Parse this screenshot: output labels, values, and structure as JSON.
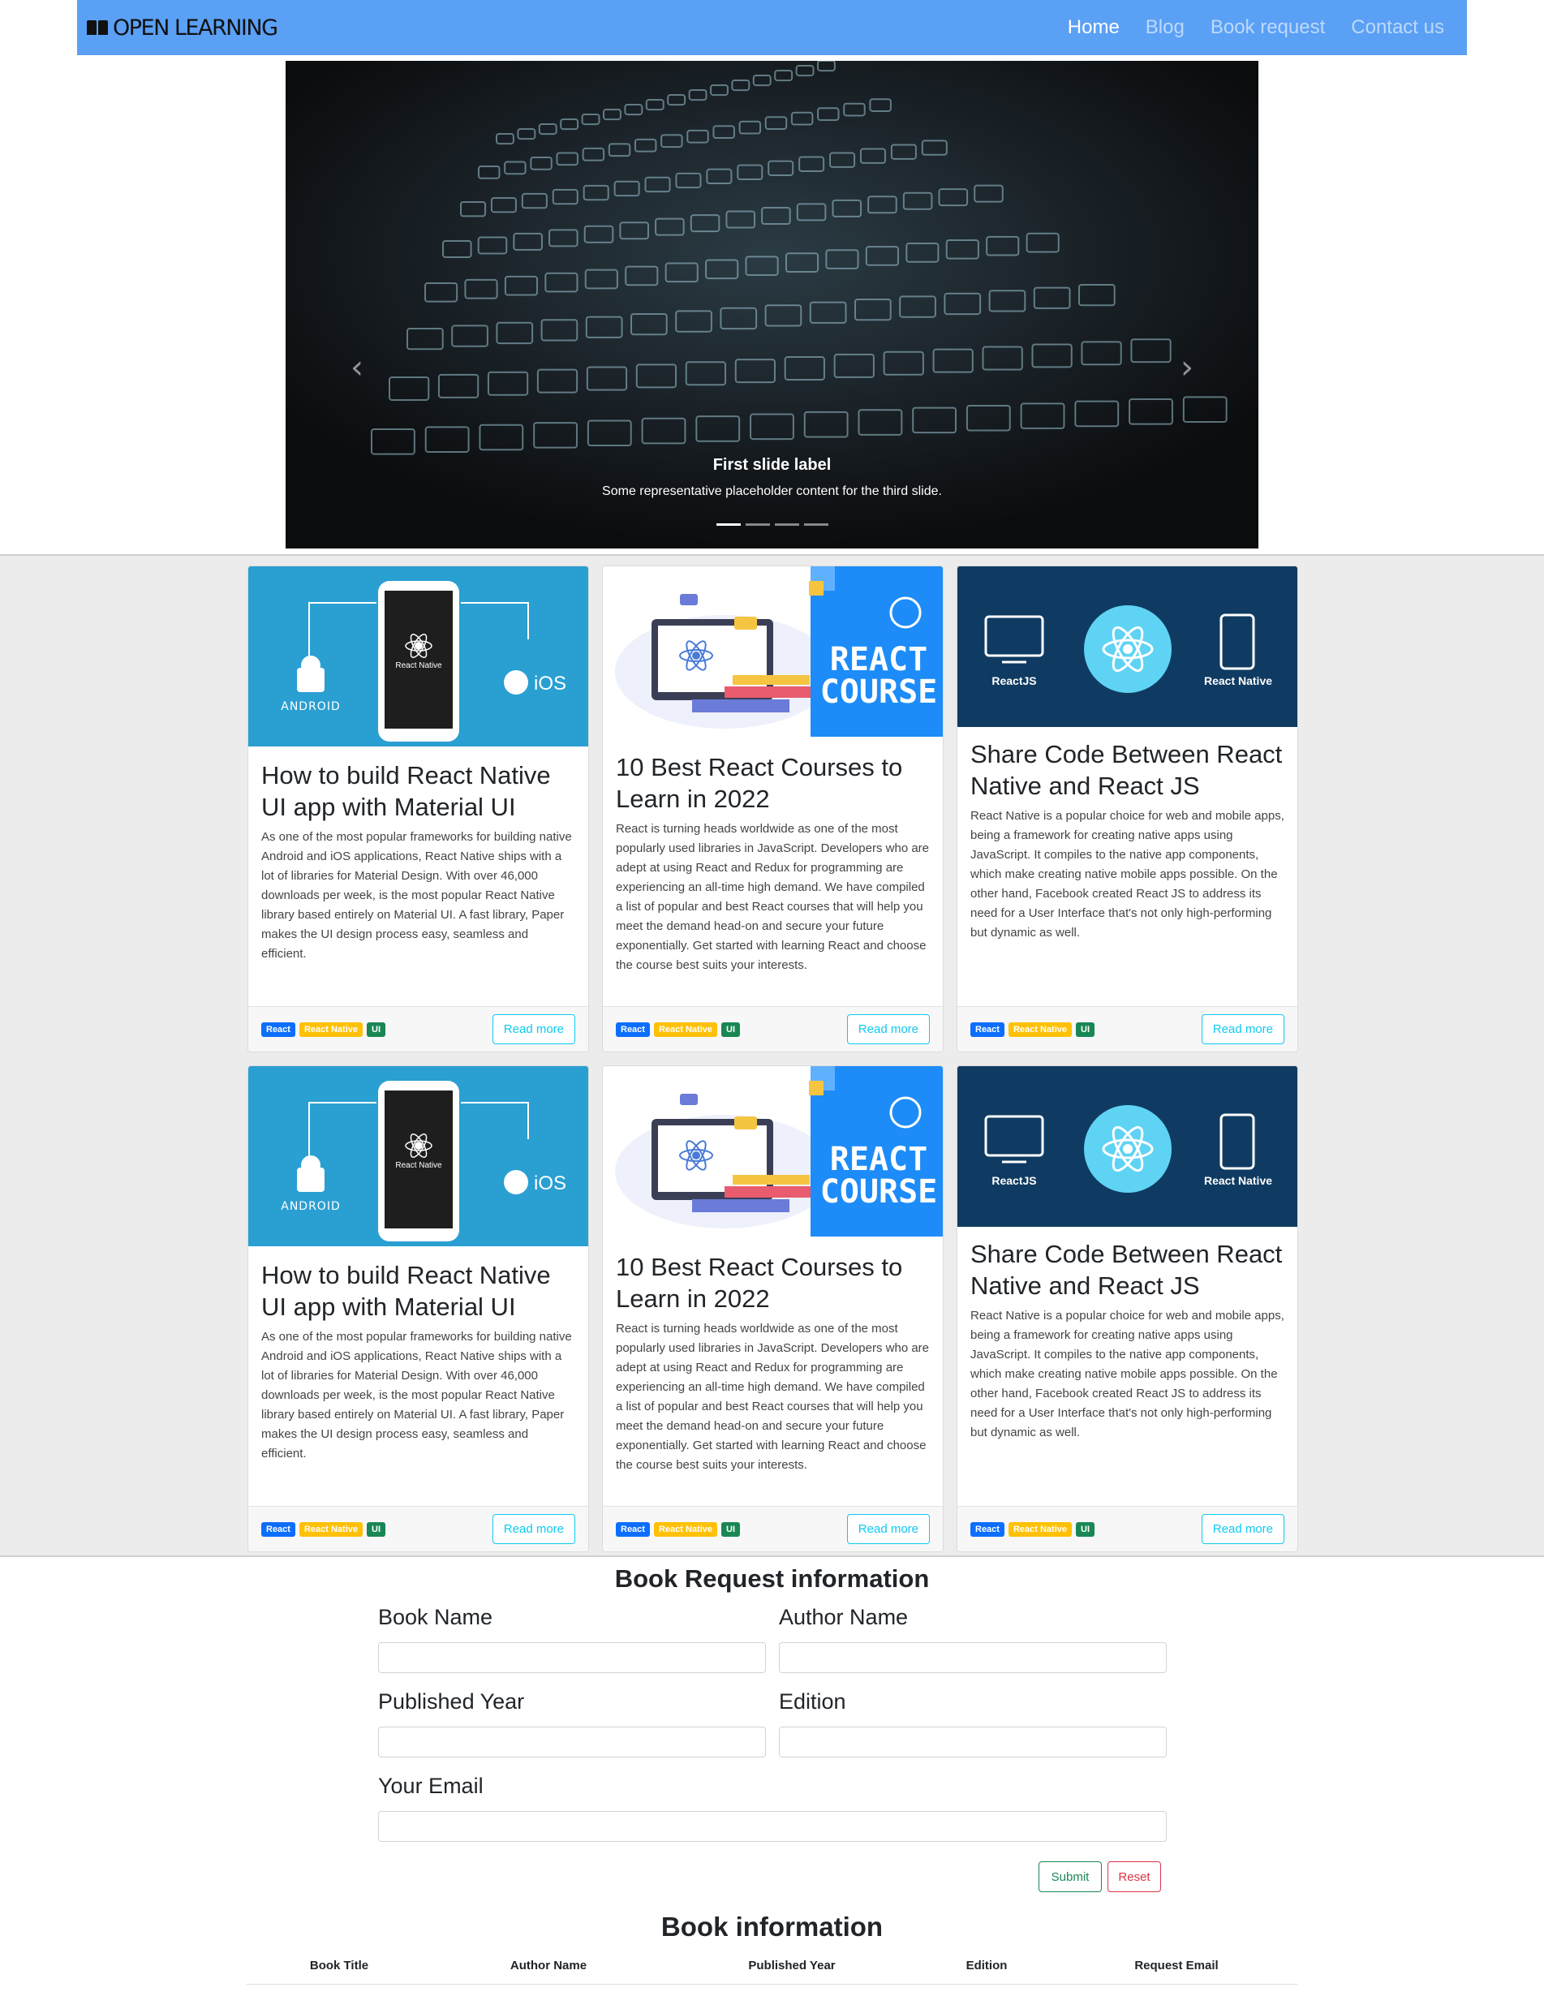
{
  "navbar": {
    "brand": "OPEN LEARNING",
    "links": [
      {
        "label": "Home",
        "active": true
      },
      {
        "label": "Blog",
        "active": false
      },
      {
        "label": "Book request",
        "active": false
      },
      {
        "label": "Contact us",
        "active": false
      }
    ]
  },
  "carousel": {
    "caption_title": "First slide label",
    "caption_text": "Some representative placeholder content for the third slide.",
    "slide_count": 4,
    "active_index": 0
  },
  "cards": [
    {
      "image": "react-native-android-ios",
      "image_labels": {
        "center": "React Native",
        "left": "ANDROID",
        "right": "iOS"
      },
      "title": "How to build React Native UI app with Material UI",
      "text": "As one of the most popular frameworks for building native Android and iOS applications, React Native ships with a lot of libraries for Material Design. With over 46,000 downloads per week, is the most popular React Native library based entirely on Material UI. A fast library, Paper makes the UI design process easy, seamless and efficient.",
      "badges": [
        "React",
        "React Native",
        "UI"
      ],
      "button": "Read more"
    },
    {
      "image": "react-course",
      "image_labels": {
        "title1": "REACT",
        "title2": "COURSE"
      },
      "title": "10 Best React Courses to Learn in 2022",
      "text": "React is turning heads worldwide as one of the most popularly used libraries in JavaScript. Developers who are adept at using React and Redux for programming are experiencing an all-time high demand. We have compiled a list of popular and best React courses that will help you meet the demand head-on and secure your future exponentially. Get started with learning React and choose the course best suits your interests.",
      "badges": [
        "React",
        "React Native",
        "UI"
      ],
      "button": "Read more"
    },
    {
      "image": "reactjs-react-native-share",
      "image_labels": {
        "left": "ReactJS",
        "right": "React Native"
      },
      "title": "Share Code Between React Native and React JS",
      "text": "React Native is a popular choice for web and mobile apps, being a framework for creating native apps using JavaScript. It compiles to the native app components, which make creating native mobile apps possible. On the other hand, Facebook created React JS to address its need for a User Interface that's not only high-performing but dynamic as well.",
      "badges": [
        "React",
        "React Native",
        "UI"
      ],
      "button": "Read more"
    },
    {
      "image": "react-native-android-ios",
      "image_labels": {
        "center": "React Native",
        "left": "ANDROID",
        "right": "iOS"
      },
      "title": "How to build React Native UI app with Material UI",
      "text": "As one of the most popular frameworks for building native Android and iOS applications, React Native ships with a lot of libraries for Material Design. With over 46,000 downloads per week, is the most popular React Native library based entirely on Material UI. A fast library, Paper makes the UI design process easy, seamless and efficient.",
      "badges": [
        "React",
        "React Native",
        "UI"
      ],
      "button": "Read more"
    },
    {
      "image": "react-course",
      "image_labels": {
        "title1": "REACT",
        "title2": "COURSE"
      },
      "title": "10 Best React Courses to Learn in 2022",
      "text": "React is turning heads worldwide as one of the most popularly used libraries in JavaScript. Developers who are adept at using React and Redux for programming are experiencing an all-time high demand. We have compiled a list of popular and best React courses that will help you meet the demand head-on and secure your future exponentially. Get started with learning React and choose the course best suits your interests.",
      "badges": [
        "React",
        "React Native",
        "UI"
      ],
      "button": "Read more"
    },
    {
      "image": "reactjs-react-native-share",
      "image_labels": {
        "left": "ReactJS",
        "right": "React Native"
      },
      "title": "Share Code Between React Native and React JS",
      "text": "React Native is a popular choice for web and mobile apps, being a framework for creating native apps using JavaScript. It compiles to the native app components, which make creating native mobile apps possible. On the other hand, Facebook created React JS to address its need for a User Interface that's not only high-performing but dynamic as well.",
      "badges": [
        "React",
        "React Native",
        "UI"
      ],
      "button": "Read more"
    }
  ],
  "form": {
    "title": "Book Request information",
    "book_name_label": "Book Name",
    "author_name_label": "Author Name",
    "published_year_label": "Published Year",
    "edition_label": "Edition",
    "email_label": "Your Email",
    "submit_label": "Submit",
    "reset_label": "Reset"
  },
  "book_info": {
    "title": "Book information",
    "columns": [
      "Book Title",
      "Author Name",
      "Published Year",
      "Edition",
      "Request Email"
    ]
  }
}
